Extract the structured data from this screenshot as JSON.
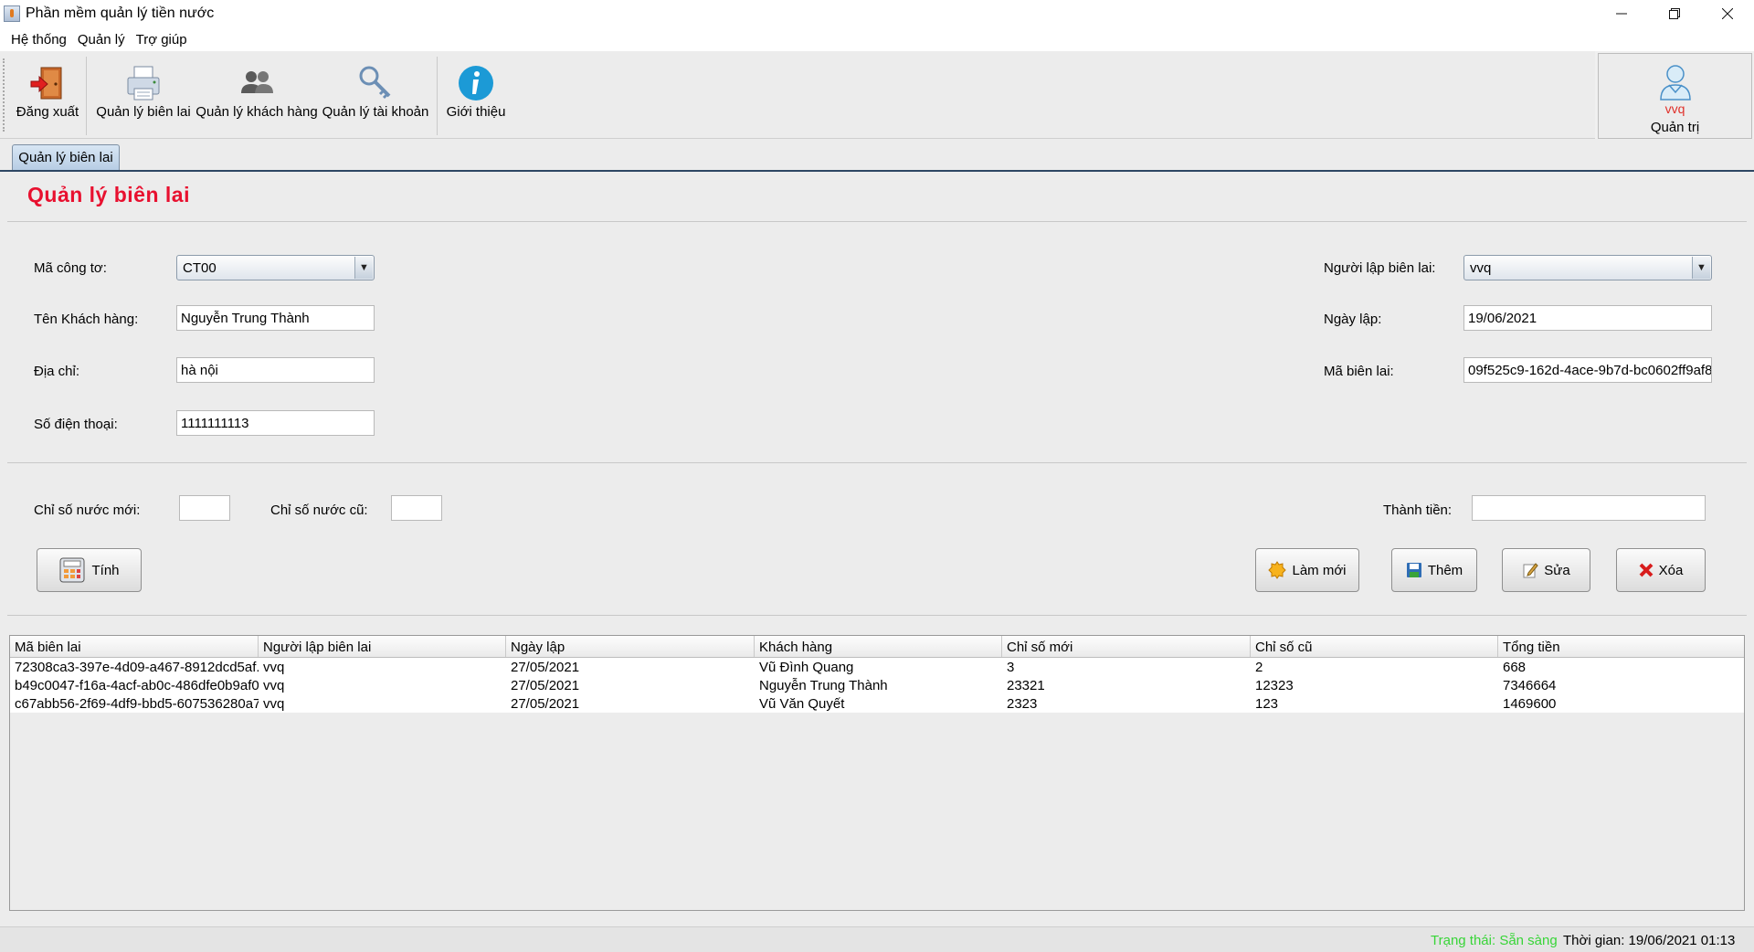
{
  "window": {
    "title": "Phần mềm quản lý tiền nước",
    "controls": [
      "minimize-icon",
      "restore-icon",
      "close-icon"
    ]
  },
  "menu": [
    {
      "label": "Hệ thống"
    },
    {
      "label": "Quản lý"
    },
    {
      "label": "Trợ giúp"
    }
  ],
  "toolbar": {
    "logout": "Đăng xuất",
    "receipts": "Quản lý biên lai",
    "customers": "Quản lý khách hàng",
    "accounts": "Quản lý tài khoản",
    "about": "Giới thiệu"
  },
  "user": {
    "name": "vvq",
    "role": "Quản trị"
  },
  "tab": {
    "label": "Quản lý biên lai"
  },
  "form": {
    "title": "Quản lý biên lai",
    "meter_label": "Mã công tơ:",
    "meter_value": "CT00",
    "customer_label": "Tên Khách hàng:",
    "customer_value": "Nguyễn Trung Thành",
    "address_label": "Địa chỉ:",
    "address_value": "hà nội",
    "phone_label": "Số điện thoại:",
    "phone_value": "1111111113",
    "creator_label": "Người lập biên lai:",
    "creator_value": "vvq",
    "date_label": "Ngày lập:",
    "date_value": "19/06/2021",
    "receipt_id_label": "Mã biên lai:",
    "receipt_id_value": "09f525c9-162d-4ace-9b7d-bc0602ff9af8",
    "new_index_label": "Chỉ số nước mới:",
    "new_index_value": "",
    "old_index_label": "Chỉ số nước cũ:",
    "old_index_value": "",
    "amount_label": "Thành tiền:",
    "amount_value": ""
  },
  "buttons": {
    "calc": "Tính",
    "refresh": "Làm mới",
    "add": "Thêm",
    "edit": "Sửa",
    "delete": "Xóa"
  },
  "table": {
    "columns": [
      "Mã biên lai",
      "Người lập biên lai",
      "Ngày lập",
      "Khách hàng",
      "Chỉ số mới",
      "Chỉ số cũ",
      "Tổng tiền"
    ],
    "rows": [
      [
        "72308ca3-397e-4d09-a467-8912dcd5af...",
        "vvq",
        "27/05/2021",
        "Vũ Đình Quang",
        "3",
        "2",
        "668"
      ],
      [
        "b49c0047-f16a-4acf-ab0c-486dfe0b9af0...",
        "vvq",
        "27/05/2021",
        "Nguyễn Trung Thành",
        "23321",
        "12323",
        "7346664"
      ],
      [
        "c67abb56-2f69-4df9-bbd5-607536280a7...",
        "vvq",
        "27/05/2021",
        "Vũ Văn Quyết",
        "2323",
        "123",
        "1469600"
      ]
    ]
  },
  "status": {
    "state": "Trạng thái: Sẵn sàng",
    "time": "Thời gian: 19/06/2021 01:13"
  },
  "colors": {
    "title_red": "#e8102f",
    "status_green": "#38d538",
    "username_red": "#e0302a"
  }
}
